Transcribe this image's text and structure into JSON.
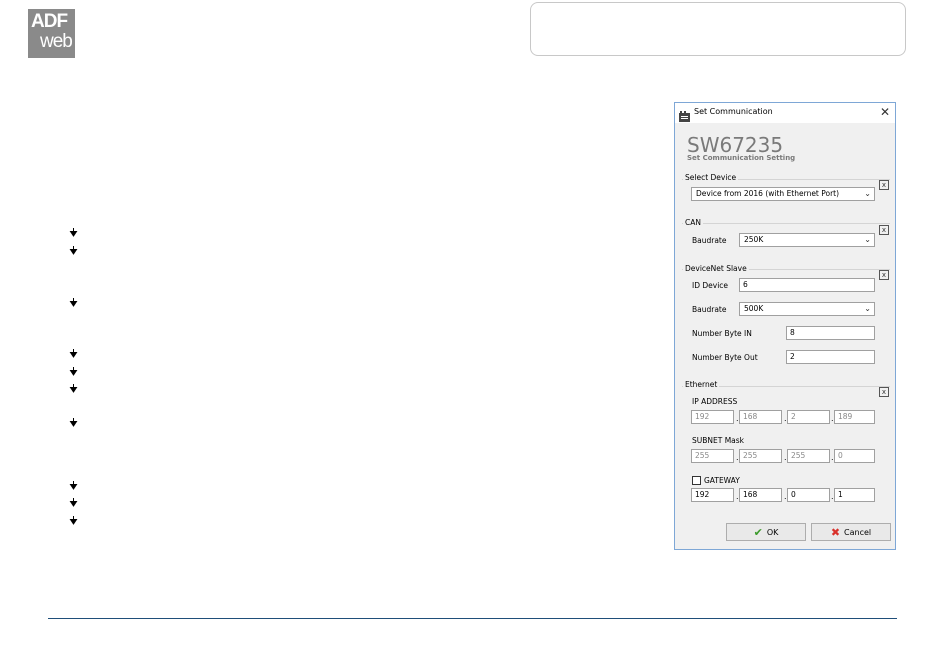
{
  "logo": {
    "line1": "ADF",
    "line2": "web"
  },
  "dialog": {
    "title": "Set Communication",
    "product_code": "SW67235",
    "subtitle": "Set Communication Setting",
    "select_device": {
      "group_label": "Select Device",
      "value": "Device from 2016 (with Ethernet Port)"
    },
    "can": {
      "group_label": "CAN",
      "baudrate_label": "Baudrate",
      "baudrate_value": "250K"
    },
    "devicenet": {
      "group_label": "DeviceNet Slave",
      "id_label": "ID Device",
      "id_value": "6",
      "baudrate_label": "Baudrate",
      "baudrate_value": "500K",
      "byte_in_label": "Number Byte IN",
      "byte_in_value": "8",
      "byte_out_label": "Number Byte Out",
      "byte_out_value": "2"
    },
    "ethernet": {
      "group_label": "Ethernet",
      "ip_label": "IP ADDRESS",
      "ip": [
        "192",
        "168",
        "2",
        "189"
      ],
      "subnet_label": "SUBNET Mask",
      "subnet": [
        "255",
        "255",
        "255",
        "0"
      ],
      "gateway_label": "GATEWAY",
      "gateway_checked": false,
      "gateway": [
        "192",
        "168",
        "0",
        "1"
      ]
    },
    "ok_label": "OK",
    "cancel_label": "Cancel"
  },
  "icons": {
    "ok": "check-icon",
    "cancel": "cross-icon",
    "close": "close-icon",
    "bullet": "arrow-bullet-icon"
  },
  "colors": {
    "footer_line": "#1f4e79",
    "logo_bg": "#8a8a8a",
    "ok_check": "#3a9a2a",
    "cancel_cross": "#d9312b"
  }
}
